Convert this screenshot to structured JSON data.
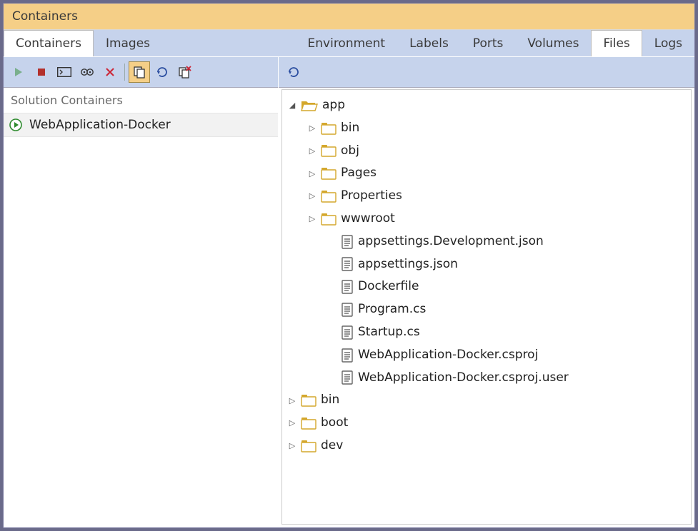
{
  "title": "Containers",
  "leftTabs": [
    {
      "label": "Containers",
      "active": true
    },
    {
      "label": "Images",
      "active": false
    }
  ],
  "rightTabs": [
    {
      "label": "Environment",
      "active": false
    },
    {
      "label": "Labels",
      "active": false
    },
    {
      "label": "Ports",
      "active": false
    },
    {
      "label": "Volumes",
      "active": false
    },
    {
      "label": "Files",
      "active": true
    },
    {
      "label": "Logs",
      "active": false
    }
  ],
  "leftToolbar": [
    {
      "icon": "play",
      "name": "start-button"
    },
    {
      "icon": "stop",
      "name": "stop-button"
    },
    {
      "icon": "terminal",
      "name": "attach-terminal-button"
    },
    {
      "icon": "gear",
      "name": "settings-button"
    },
    {
      "icon": "delete",
      "name": "remove-button"
    },
    {
      "sep": true
    },
    {
      "icon": "copy",
      "name": "copy-button",
      "active": true
    },
    {
      "icon": "refresh",
      "name": "refresh-button"
    },
    {
      "icon": "prune",
      "name": "prune-button"
    }
  ],
  "rightToolbar": [
    {
      "icon": "refresh",
      "name": "refresh-files-button"
    }
  ],
  "sectionHeader": "Solution Containers",
  "containers": [
    {
      "label": "WebApplication-Docker",
      "running": true
    }
  ],
  "tree": [
    {
      "depth": 0,
      "icon": "folder-open",
      "label": "app",
      "caret": "down"
    },
    {
      "depth": 1,
      "icon": "folder",
      "label": "bin",
      "caret": "right"
    },
    {
      "depth": 1,
      "icon": "folder",
      "label": "obj",
      "caret": "right"
    },
    {
      "depth": 1,
      "icon": "folder",
      "label": "Pages",
      "caret": "right"
    },
    {
      "depth": 1,
      "icon": "folder",
      "label": "Properties",
      "caret": "right"
    },
    {
      "depth": 1,
      "icon": "folder",
      "label": "wwwroot",
      "caret": "right"
    },
    {
      "depth": 2,
      "icon": "file",
      "label": "appsettings.Development.json",
      "caret": "none"
    },
    {
      "depth": 2,
      "icon": "file",
      "label": "appsettings.json",
      "caret": "none"
    },
    {
      "depth": 2,
      "icon": "file",
      "label": "Dockerfile",
      "caret": "none"
    },
    {
      "depth": 2,
      "icon": "file",
      "label": "Program.cs",
      "caret": "none"
    },
    {
      "depth": 2,
      "icon": "file",
      "label": "Startup.cs",
      "caret": "none"
    },
    {
      "depth": 2,
      "icon": "file",
      "label": "WebApplication-Docker.csproj",
      "caret": "none"
    },
    {
      "depth": 2,
      "icon": "file",
      "label": "WebApplication-Docker.csproj.user",
      "caret": "none"
    },
    {
      "depth": 0,
      "icon": "folder",
      "label": "bin",
      "caret": "right"
    },
    {
      "depth": 0,
      "icon": "folder",
      "label": "boot",
      "caret": "right"
    },
    {
      "depth": 0,
      "icon": "folder",
      "label": "dev",
      "caret": "right"
    }
  ]
}
